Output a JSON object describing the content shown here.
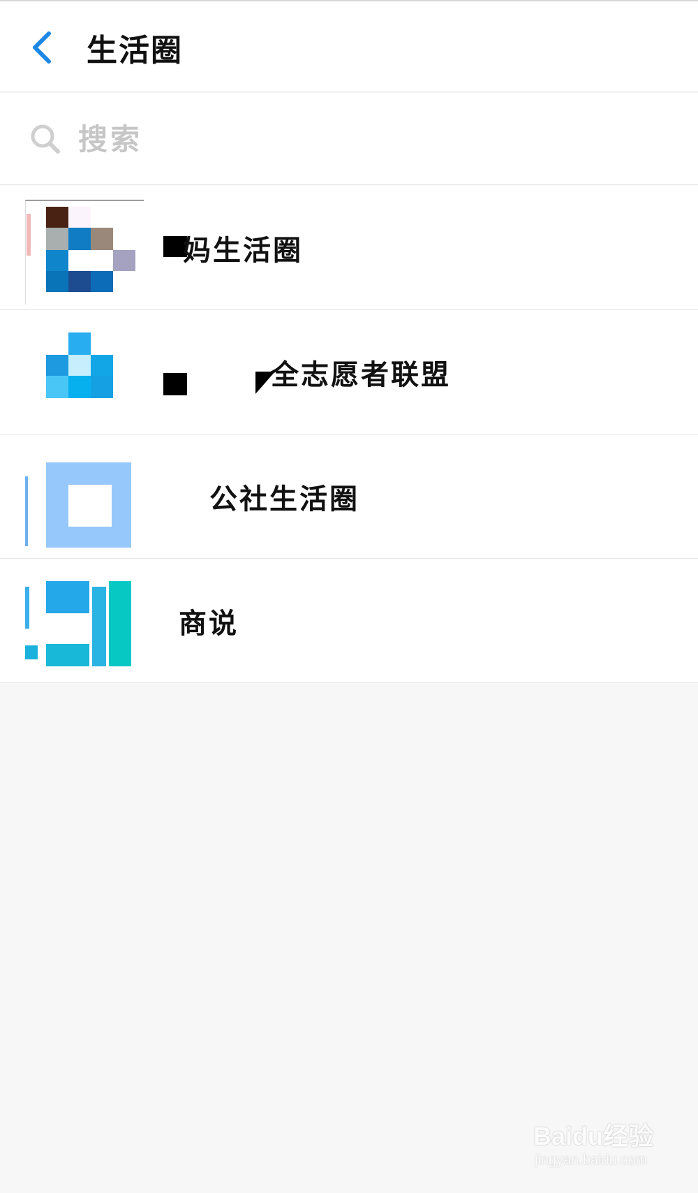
{
  "header": {
    "title": "生活圈",
    "back_icon": "chevron-left-icon",
    "accent_color": "#1e88e5"
  },
  "search": {
    "placeholder": "搜索",
    "value": "",
    "icon": "search-icon"
  },
  "list": {
    "items": [
      {
        "label": "妈生活圈",
        "avatar": "pixelated-avatar"
      },
      {
        "label": "全志愿者联盟",
        "avatar": "pixelated-avatar"
      },
      {
        "label": "公社生活圈",
        "avatar": "pixelated-avatar"
      },
      {
        "label": "商说",
        "avatar": "pixelated-avatar"
      }
    ]
  },
  "watermark": {
    "brand": "Baidu经验",
    "url": "jingyan.baidu.com"
  },
  "colors": {
    "background": "#f7f7f7",
    "surface": "#ffffff",
    "divider": "#e6e6e6",
    "placeholder": "#c6c6c6"
  }
}
